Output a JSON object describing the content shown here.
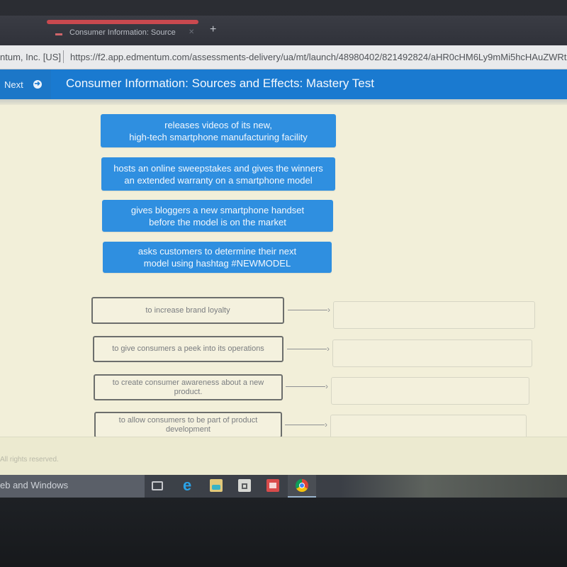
{
  "browser": {
    "tab_title": "Consumer Information: Source",
    "tab_close_icon": "close-icon",
    "new_tab_icon": "plus-icon",
    "site_identity": "ntum, Inc. [US]",
    "url": "https://f2.app.edmentum.com/assessments-delivery/ua/mt/launch/48980402/821492824/aHR0cHM6Ly9mMi5hcHAuZWRtZW5"
  },
  "header": {
    "next_label": "Next",
    "next_icon": "arrow-right-circle-icon",
    "title": "Consumer Information: Sources and Effects: Mastery Test",
    "accent_color": "#1a7ad0"
  },
  "options": [
    {
      "line1": "releases videos of its new,",
      "line2": "high-tech smartphone manufacturing facility"
    },
    {
      "line1": "hosts an online sweepstakes and gives the winners",
      "line2": "an extended warranty on a smartphone model"
    },
    {
      "line1": "gives bloggers a new smartphone handset",
      "line2": "before the model is on the market"
    },
    {
      "line1": "asks customers to determine their next",
      "line2": "model using hashtag #NEWMODEL"
    }
  ],
  "goals": [
    {
      "label": "to increase brand loyalty",
      "target_value": ""
    },
    {
      "label": "to give consumers a peek into its operations",
      "target_value": ""
    },
    {
      "label": "to create consumer awareness about a new product.",
      "target_value": ""
    },
    {
      "label": "to allow consumers to be part of product development",
      "target_value": ""
    }
  ],
  "footer": {
    "copyright": "All rights reserved."
  },
  "taskbar": {
    "search_text": "eb and Windows",
    "icons": [
      "task-view-icon",
      "edge-icon",
      "file-explorer-icon",
      "store-icon",
      "mail-icon",
      "chrome-icon"
    ]
  }
}
